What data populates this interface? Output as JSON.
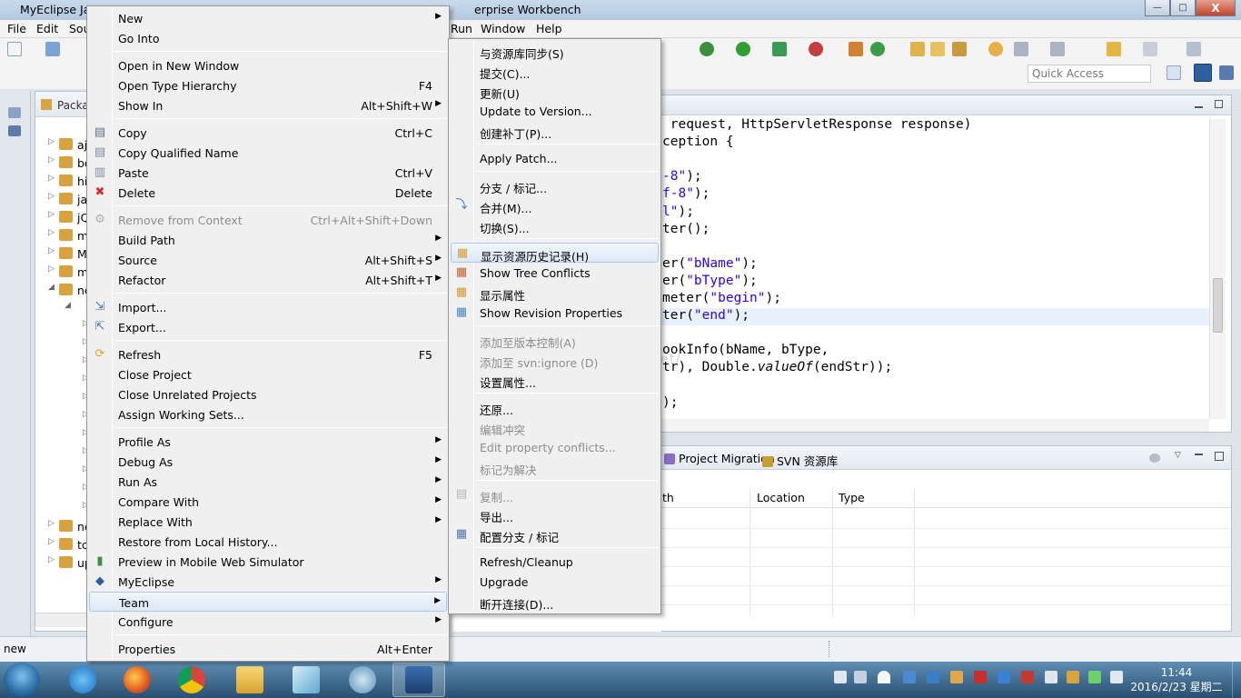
{
  "window": {
    "title_left": "MyEclipse Jav",
    "title_right": "erprise Workbench",
    "controls": {
      "minimize": "—",
      "maximize": "□",
      "close": "X"
    }
  },
  "menubar": {
    "file": "File",
    "edit": "Edit",
    "source": "Sou",
    "run": "Run",
    "window": "Window",
    "help": "Help"
  },
  "toolbar": {
    "quick_access_placeholder": "Quick Access"
  },
  "package_explorer": {
    "title": "Packa",
    "rows": [
      "aj",
      "bo",
      "hi",
      "ja",
      "jQ",
      "m",
      "M",
      "m",
      "ne",
      "ne",
      "tc",
      "up"
    ]
  },
  "editor": {
    "lines": [
      {
        "t": " request, HttpServletResponse response)"
      },
      {
        "t": "ception {"
      },
      {
        "t": ""
      },
      {
        "s": "-8\"",
        "t2": ");"
      },
      {
        "s": "f-8\"",
        "t2": ");"
      },
      {
        "s": "l\"",
        "t2": ");"
      },
      {
        "t": "ter();"
      },
      {
        "t": ""
      },
      {
        "t": "er(",
        "s": "\"bName\"",
        "t2": ");"
      },
      {
        "t": "er(",
        "s": "\"bType\"",
        "t2": ");"
      },
      {
        "t": "meter(",
        "s": "\"begin\"",
        "t2": ");"
      },
      {
        "t": "ter(",
        "s": "\"end\"",
        "t2": ");"
      },
      {
        "t": ""
      },
      {
        "t": "ookInfo(bName, bType,"
      },
      {
        "t": "tr), Double.",
        "i": "valueOf",
        "t2": "(endStr));"
      },
      {
        "t": ""
      },
      {
        "t": ");"
      }
    ]
  },
  "bottom_view": {
    "tabs": [
      "Project Migration",
      "SVN 资源库"
    ],
    "columns": [
      "th",
      "Location",
      "Type"
    ]
  },
  "statusbar": {
    "text": "new"
  },
  "watermark": "://blog.csdn.net/",
  "context_menu": {
    "items": [
      {
        "label": "New",
        "sub": true
      },
      {
        "label": "Go Into"
      },
      {
        "sep": true
      },
      {
        "label": "Open in New Window"
      },
      {
        "label": "Open Type Hierarchy",
        "acc": "F4"
      },
      {
        "label": "Show In",
        "acc": "Alt+Shift+W",
        "sub": true
      },
      {
        "sep": true
      },
      {
        "label": "Copy",
        "acc": "Ctrl+C",
        "icon": "copy-icon"
      },
      {
        "label": "Copy Qualified Name",
        "icon": "copy-qualified-icon"
      },
      {
        "label": "Paste",
        "acc": "Ctrl+V",
        "icon": "paste-icon"
      },
      {
        "label": "Delete",
        "acc": "Delete",
        "icon": "delete-icon"
      },
      {
        "sep": true
      },
      {
        "label": "Remove from Context",
        "acc": "Ctrl+Alt+Shift+Down",
        "disabled": true,
        "icon": "remove-context-icon"
      },
      {
        "label": "Build Path",
        "sub": true
      },
      {
        "label": "Source",
        "acc": "Alt+Shift+S",
        "sub": true
      },
      {
        "label": "Refactor",
        "acc": "Alt+Shift+T",
        "sub": true
      },
      {
        "sep": true
      },
      {
        "label": "Import...",
        "icon": "import-icon"
      },
      {
        "label": "Export...",
        "icon": "export-icon"
      },
      {
        "sep": true
      },
      {
        "label": "Refresh",
        "acc": "F5",
        "icon": "refresh-icon"
      },
      {
        "label": "Close Project"
      },
      {
        "label": "Close Unrelated Projects"
      },
      {
        "label": "Assign Working Sets..."
      },
      {
        "sep": true
      },
      {
        "label": "Profile As",
        "sub": true
      },
      {
        "label": "Debug As",
        "sub": true
      },
      {
        "label": "Run As",
        "sub": true
      },
      {
        "label": "Compare With",
        "sub": true
      },
      {
        "label": "Replace With",
        "sub": true
      },
      {
        "label": "Restore from Local History..."
      },
      {
        "label": "Preview in Mobile Web Simulator",
        "icon": "mobile-preview-icon"
      },
      {
        "label": "MyEclipse",
        "sub": true,
        "icon": "myeclipse-icon"
      },
      {
        "label": "Team",
        "sub": true,
        "highlight": true
      },
      {
        "label": "Configure",
        "sub": true
      },
      {
        "sep": true
      },
      {
        "label": "Properties",
        "acc": "Alt+Enter"
      }
    ]
  },
  "team_menu": {
    "items": [
      {
        "label": "与资源库同步(S)"
      },
      {
        "label": "提交(C)..."
      },
      {
        "label": "更新(U)"
      },
      {
        "label": "Update to Version..."
      },
      {
        "label": "创建补丁(P)..."
      },
      {
        "sep": true
      },
      {
        "label": "Apply Patch..."
      },
      {
        "sep": true
      },
      {
        "label": "分支 / 标记..."
      },
      {
        "label": "合并(M)...",
        "icon": "merge-icon"
      },
      {
        "label": "切换(S)..."
      },
      {
        "sep": true
      },
      {
        "label": "显示资源历史记录(H)",
        "highlight": true,
        "icon": "history-icon"
      },
      {
        "label": "Show Tree Conflicts",
        "icon": "tree-conflicts-icon"
      },
      {
        "label": "显示属性",
        "icon": "show-properties-icon"
      },
      {
        "label": "Show Revision Properties",
        "icon": "revision-properties-icon"
      },
      {
        "sep": true
      },
      {
        "label": "添加至版本控制(A)",
        "disabled": true
      },
      {
        "label": "添加至 svn:ignore (D)",
        "disabled": true
      },
      {
        "label": "设置属性..."
      },
      {
        "sep": true
      },
      {
        "label": "还原..."
      },
      {
        "label": "编辑冲突",
        "disabled": true
      },
      {
        "label": "Edit property conflicts...",
        "disabled": true
      },
      {
        "label": "标记为解决",
        "disabled": true
      },
      {
        "sep": true
      },
      {
        "label": "复制...",
        "disabled": true,
        "icon": "copy-svn-icon"
      },
      {
        "label": "导出..."
      },
      {
        "label": "配置分支 / 标记",
        "icon": "branch-config-icon"
      },
      {
        "sep": true
      },
      {
        "label": "Refresh/Cleanup"
      },
      {
        "label": "Upgrade"
      },
      {
        "label": "断开连接(D)..."
      }
    ]
  },
  "taskbar": {
    "clock_time": "11:44",
    "clock_date": "2016/2/23 星期二"
  }
}
